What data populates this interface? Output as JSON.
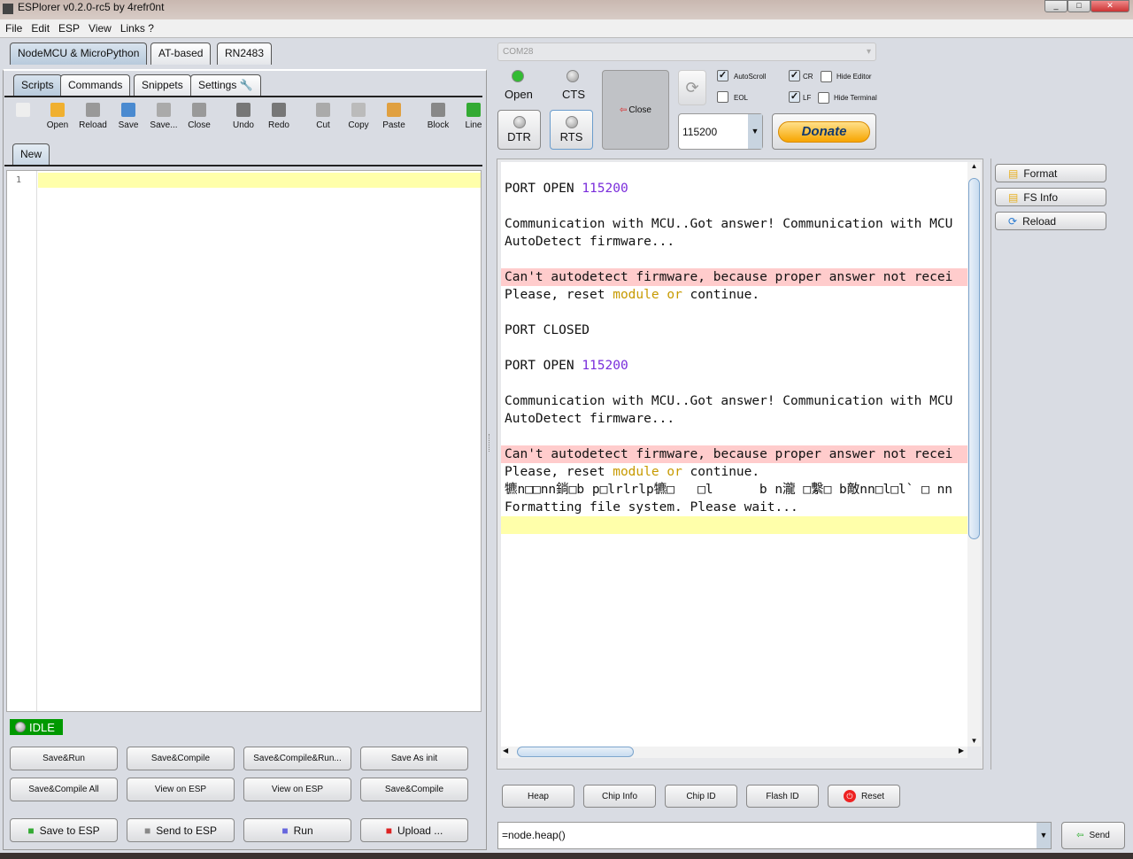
{
  "window": {
    "title": "ESPlorer v0.2.0-rc5 by 4refr0nt"
  },
  "menu": [
    "File",
    "Edit",
    "ESP",
    "View",
    "Links ?"
  ],
  "device_tabs": [
    "NodeMCU & MicroPython",
    "AT-based",
    "RN2483"
  ],
  "sub_tabs": [
    "Scripts",
    "Commands",
    "Snippets",
    "Settings"
  ],
  "toolbar": [
    {
      "label": "",
      "icon": "new-file-icon"
    },
    {
      "label": "Open",
      "icon": "folder-open-icon"
    },
    {
      "label": "Reload",
      "icon": "reload-icon"
    },
    {
      "label": "Save",
      "icon": "floppy-icon"
    },
    {
      "label": "Save...",
      "icon": "save-as-icon"
    },
    {
      "label": "Close",
      "icon": "close-file-icon"
    },
    {
      "label": "Undo",
      "icon": "undo-icon"
    },
    {
      "label": "Redo",
      "icon": "redo-icon"
    },
    {
      "label": "Cut",
      "icon": "scissors-icon"
    },
    {
      "label": "Copy",
      "icon": "copy-icon"
    },
    {
      "label": "Paste",
      "icon": "paste-icon"
    },
    {
      "label": "Block",
      "icon": "block-icon"
    },
    {
      "label": "Line",
      "icon": "line-icon"
    }
  ],
  "file_tab": "New",
  "editor": {
    "line_number": "1"
  },
  "status": {
    "label": "IDLE",
    "color": "#009900"
  },
  "script_buttons": [
    "Save&Run",
    "Save&Compile",
    "Save&Compile&Run...",
    "Save As init",
    "Save&Compile All",
    "View on ESP",
    "View on ESP",
    "Save&Compile"
  ],
  "bottom_buttons": [
    {
      "label": "Save to ESP",
      "icon": "save-to-esp-icon"
    },
    {
      "label": "Send to ESP",
      "icon": "send-script-icon"
    },
    {
      "label": "Run",
      "icon": "play-icon"
    },
    {
      "label": "Upload ...",
      "icon": "upload-icon"
    }
  ],
  "port": {
    "value": "COM28",
    "open_label": "Open",
    "cts_label": "CTS",
    "dtr_label": "DTR",
    "rts_label": "RTS",
    "close_label": "Close",
    "baud": "115200",
    "donate": "Donate",
    "open_led": "#33bb33"
  },
  "options": {
    "autoscroll": {
      "label": "AutoScroll",
      "checked": true
    },
    "eol": {
      "label": "EOL",
      "checked": false
    },
    "cr": {
      "label": "CR",
      "checked": true
    },
    "lf": {
      "label": "LF",
      "checked": true
    },
    "hide_editor": {
      "label": "Hide Editor",
      "checked": false
    },
    "hide_terminal": {
      "label": "Hide Terminal",
      "checked": false
    }
  },
  "terminal": {
    "lines": [
      [],
      [
        [
          "PORT OPEN ",
          ""
        ],
        [
          "115200",
          "kw"
        ]
      ],
      [],
      [
        [
          "Communication with MCU..Got answer! Communication with MCU",
          ""
        ]
      ],
      [
        [
          "AutoDetect firmware...",
          ""
        ]
      ],
      [],
      [
        [
          "Can",
          ""
        ],
        [
          "'t autodetect firmware, because proper answer not recei",
          "pink"
        ]
      ],
      [
        [
          "Please, reset ",
          ""
        ],
        [
          "module",
          "y"
        ],
        [
          " ",
          ""
        ],
        [
          "or",
          "y"
        ],
        [
          " continue.",
          ""
        ]
      ],
      [],
      [
        [
          "PORT CLOSED",
          ""
        ]
      ],
      [],
      [
        [
          "PORT OPEN ",
          ""
        ],
        [
          "115200",
          "kw"
        ]
      ],
      [],
      [
        [
          "Communication with MCU..Got answer! Communication with MCU",
          ""
        ]
      ],
      [
        [
          "AutoDetect firmware...",
          ""
        ]
      ],
      [],
      [
        [
          "Can",
          ""
        ],
        [
          "'t autodetect firmware, because proper answer not recei",
          "pink"
        ]
      ],
      [
        [
          "Please, reset ",
          ""
        ],
        [
          "module",
          "y"
        ],
        [
          " ",
          ""
        ],
        [
          "or",
          "y"
        ],
        [
          " continue.",
          ""
        ]
      ],
      [
        [
          "犥n□□nn鋿□b p□lrlrlp犥□   □l      b n瀧 □繫□ b敵nn□l□l` □ nn",
          ""
        ]
      ],
      [
        [
          "Formatting file system. Please wait...",
          ""
        ]
      ]
    ]
  },
  "fs_buttons": [
    {
      "label": "Format",
      "icon": "format-fs-icon"
    },
    {
      "label": "FS Info",
      "icon": "fs-info-icon"
    },
    {
      "label": "Reload",
      "icon": "refresh-icon"
    }
  ],
  "command_buttons": [
    "Heap",
    "Chip Info",
    "Chip ID",
    "Flash ID",
    "Reset"
  ],
  "command_input": {
    "value": "=node.heap()"
  },
  "send_label": "Send"
}
